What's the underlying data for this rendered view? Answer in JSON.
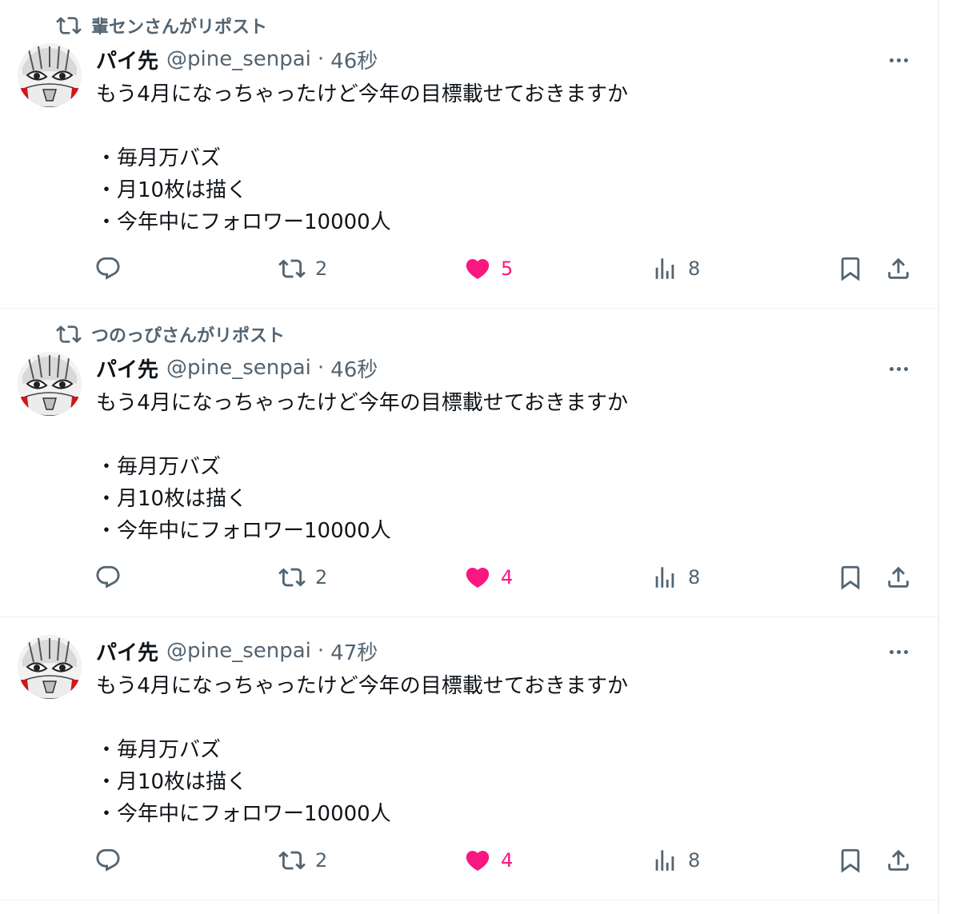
{
  "colors": {
    "text": "#0f1419",
    "secondary": "#536471",
    "like": "#f91880",
    "divider": "#eff3f4"
  },
  "icons": {
    "repost": "repost-icon",
    "reply": "reply-icon",
    "retweet": "retweet-icon",
    "like": "heart-filled-icon",
    "views": "analytics-icon",
    "bookmark": "bookmark-icon",
    "share": "share-icon",
    "more": "more-horizontal-icon"
  },
  "tweets": [
    {
      "repost_label": "輩センさんがリポスト",
      "name": "パイ先",
      "handle": "@pine_senpai",
      "dot": "·",
      "time": "46秒",
      "lines": [
        "もう4月になっちゃったけど今年の目標載せておきますか",
        "",
        "・毎月万バズ",
        "・月10枚は描く",
        "・今年中にフォロワー10000人"
      ],
      "retweets": "2",
      "likes": "5",
      "views": "8",
      "liked": true
    },
    {
      "repost_label": "つのっぴさんがリポスト",
      "name": "パイ先",
      "handle": "@pine_senpai",
      "dot": "·",
      "time": "46秒",
      "lines": [
        "もう4月になっちゃったけど今年の目標載せておきますか",
        "",
        "・毎月万バズ",
        "・月10枚は描く",
        "・今年中にフォロワー10000人"
      ],
      "retweets": "2",
      "likes": "4",
      "views": "8",
      "liked": true
    },
    {
      "repost_label": "",
      "name": "パイ先",
      "handle": "@pine_senpai",
      "dot": "·",
      "time": "47秒",
      "lines": [
        "もう4月になっちゃったけど今年の目標載せておきますか",
        "",
        "・毎月万バズ",
        "・月10枚は描く",
        "・今年中にフォロワー10000人"
      ],
      "retweets": "2",
      "likes": "4",
      "views": "8",
      "liked": true
    }
  ]
}
